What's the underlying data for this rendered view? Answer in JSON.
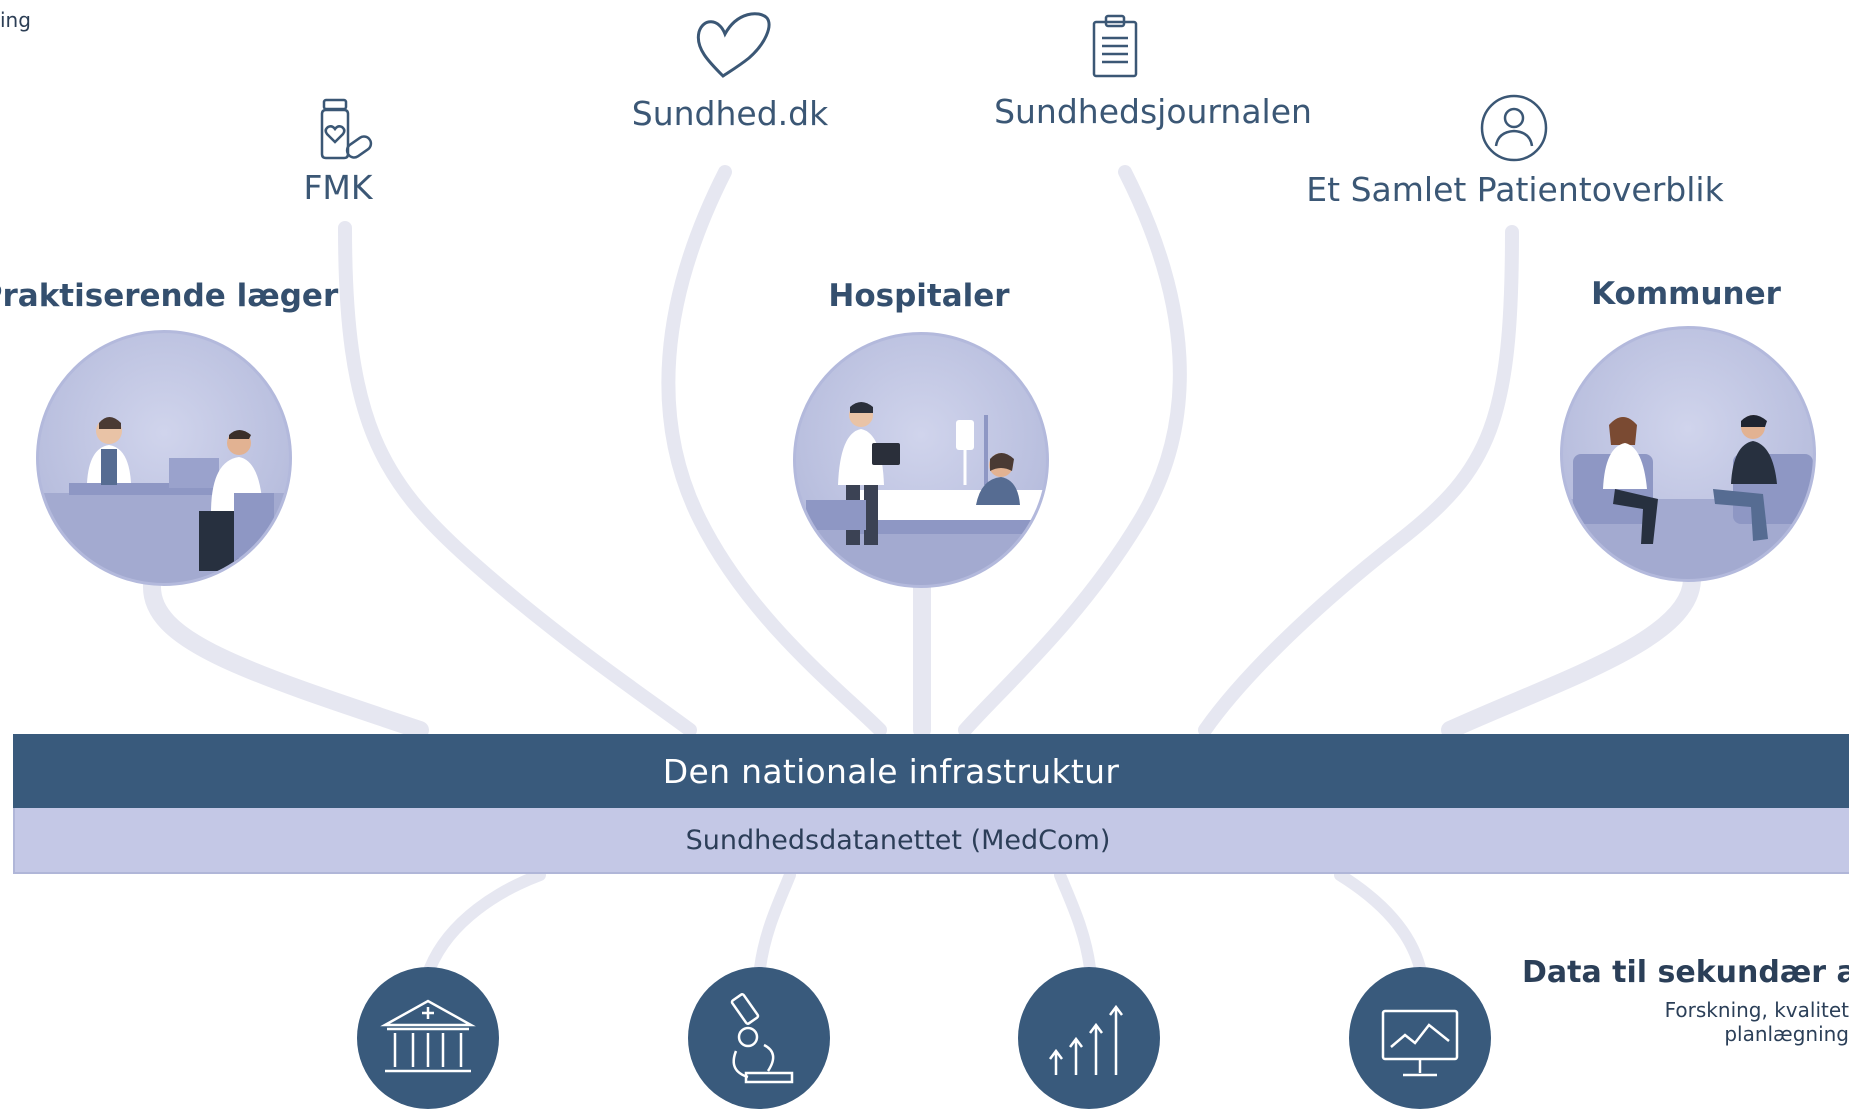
{
  "corner_text": "ing",
  "top_systems": [
    {
      "id": "fmk",
      "label": "FMK",
      "icon": "medicine-bottle-icon"
    },
    {
      "id": "sundhed",
      "label": "Sundhed.dk",
      "icon": "heart-icon"
    },
    {
      "id": "journal",
      "label": "Sundhedsjournalen",
      "icon": "clipboard-icon"
    },
    {
      "id": "overblik",
      "label": "Et Samlet Patientoverblik",
      "icon": "person-icon"
    }
  ],
  "groups": [
    {
      "id": "laeger",
      "label": "Praktiserende læger",
      "illustration": "doctor-consultation-illustration"
    },
    {
      "id": "hospitaler",
      "label": "Hospitaler",
      "illustration": "hospital-bed-illustration"
    },
    {
      "id": "kommuner",
      "label": "Kommuner",
      "illustration": "municipal-conversation-illustration"
    }
  ],
  "infrastructure": {
    "title": "Den nationale infrastruktur",
    "subtitle": "Sundhedsdatanettet (MedCom)"
  },
  "bottom_icons": [
    "institution-icon",
    "microscope-icon",
    "growth-arrows-icon",
    "monitor-chart-icon"
  ],
  "secondary": {
    "title": "Data til sekundær anve",
    "sub_line1": "Forskning, kvalitet",
    "sub_line2": "planlægning"
  },
  "colors": {
    "dark_blue": "#395a7c",
    "light_lavender": "#c4c8e6",
    "link_color": "#e4e5f0",
    "text_blue": "#3b5775"
  }
}
